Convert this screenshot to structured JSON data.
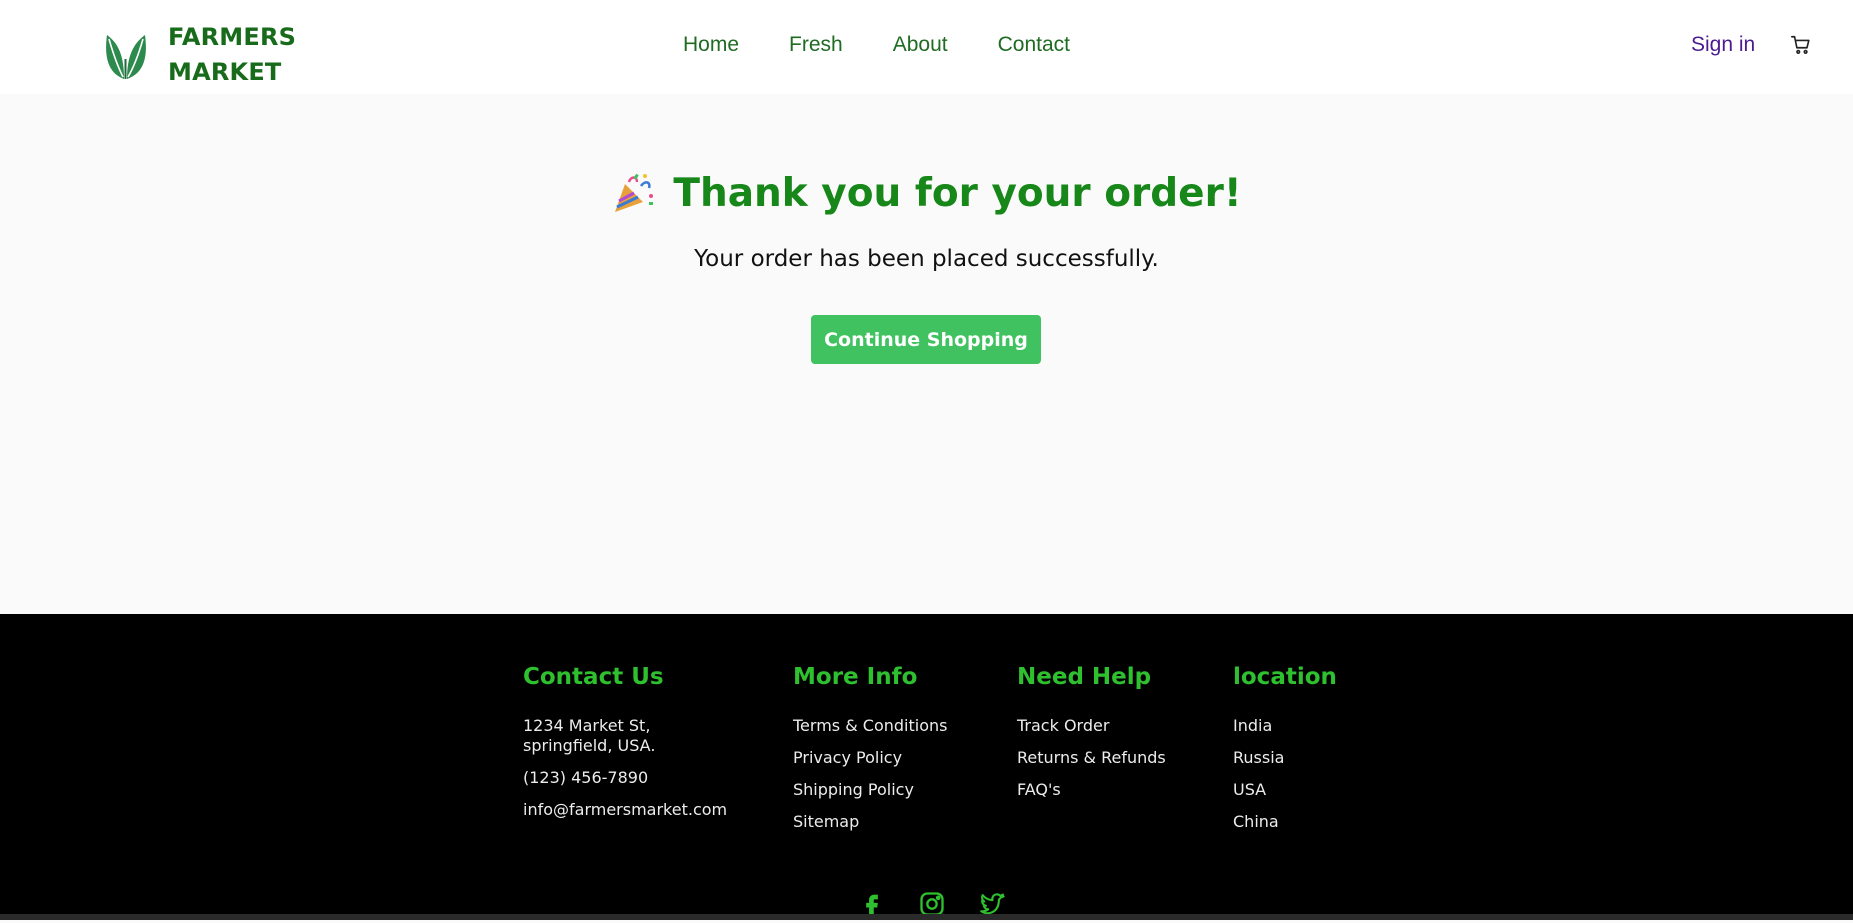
{
  "brand": {
    "line1": "FARMERS",
    "line2": "MARKET",
    "icon": "leaf-logo-icon",
    "color": "#176b1a"
  },
  "nav": {
    "items": [
      {
        "label": "Home"
      },
      {
        "label": "Fresh"
      },
      {
        "label": "About"
      },
      {
        "label": "Contact"
      }
    ],
    "sign_in": "Sign in",
    "cart_icon": "cart-icon"
  },
  "order": {
    "emoji_icon": "party-popper-icon",
    "title": "Thank you for your order!",
    "message": "Your order has been placed successfully.",
    "button_label": "Continue Shopping",
    "button_color": "#3fc25f",
    "title_color": "#168718"
  },
  "footer": {
    "contact": {
      "heading": "Contact Us",
      "address_line1": "1234 Market St,",
      "address_line2": "springfield, USA.",
      "phone": "(123) 456-7890",
      "email": "info@farmersmarket.com"
    },
    "more_info": {
      "heading": "More Info",
      "links": [
        "Terms & Conditions",
        "Privacy Policy",
        "Shipping Policy",
        "Sitemap"
      ]
    },
    "need_help": {
      "heading": "Need Help",
      "links": [
        "Track Order",
        "Returns & Refunds",
        "FAQ's"
      ]
    },
    "location": {
      "heading": "location",
      "items": [
        "India",
        "Russia",
        "USA",
        "China"
      ]
    },
    "socials": [
      "facebook-icon",
      "instagram-icon",
      "twitter-icon"
    ],
    "heading_color": "#2ec02e"
  }
}
